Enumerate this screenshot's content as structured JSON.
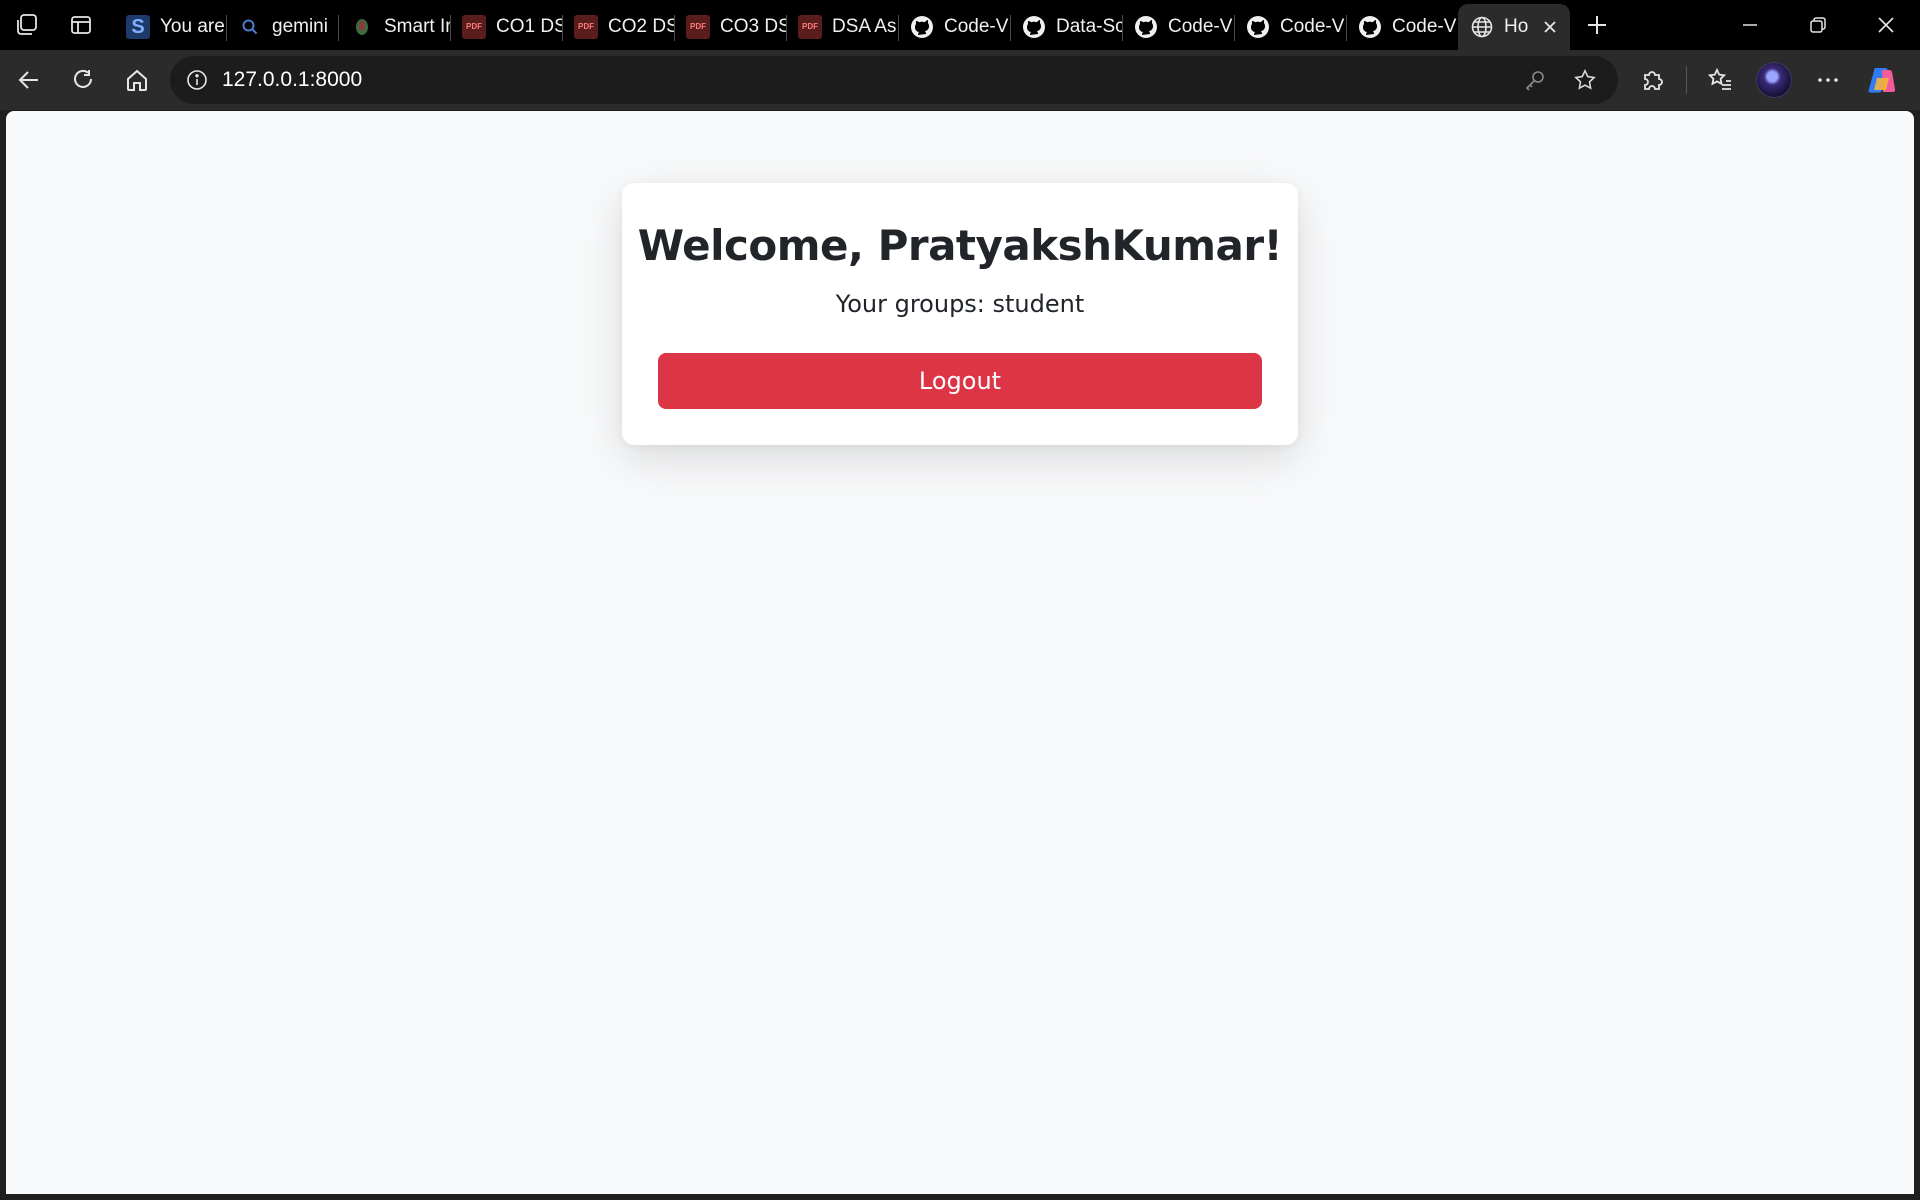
{
  "browser": {
    "tabs": [
      {
        "label": "You are",
        "icon": "s-favicon-icon"
      },
      {
        "label": "gemini",
        "icon": "search-favicon-icon"
      },
      {
        "label": "Smart Ir",
        "icon": "leaf-favicon-icon"
      },
      {
        "label": "CO1 DS",
        "icon": "pdf-icon"
      },
      {
        "label": "CO2 DS",
        "icon": "pdf-icon"
      },
      {
        "label": "CO3 DS",
        "icon": "pdf-icon"
      },
      {
        "label": "DSA As",
        "icon": "pdf-icon"
      },
      {
        "label": "Code-V",
        "icon": "github-icon"
      },
      {
        "label": "Data-Sc",
        "icon": "github-icon"
      },
      {
        "label": "Code-V",
        "icon": "github-icon"
      },
      {
        "label": "Code-V",
        "icon": "github-icon"
      },
      {
        "label": "Code-V",
        "icon": "github-icon"
      },
      {
        "label": "Ho",
        "icon": "globe-icon",
        "active": true
      }
    ],
    "pdf_badge": "PDF",
    "address": {
      "url": "127.0.0.1:8000"
    }
  },
  "page": {
    "welcome": "Welcome, PratyakshKumar!",
    "groups_text": "Your groups: student",
    "logout_label": "Logout"
  },
  "colors": {
    "page_bg": "#f8f9fa",
    "card_bg": "#ffffff",
    "danger": "#dc3545",
    "text": "#212529"
  }
}
